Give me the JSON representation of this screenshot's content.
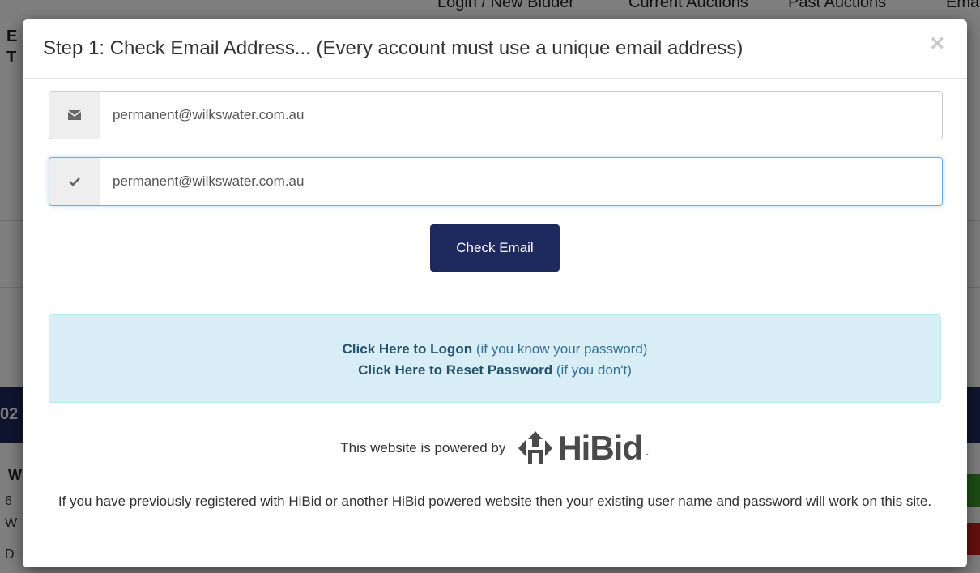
{
  "background": {
    "nav": [
      "Login / New Bidder",
      "Current Auctions",
      "Past Auctions",
      "Ema"
    ],
    "left_letters": [
      "E",
      "T"
    ],
    "banner_text": "02",
    "left_col": [
      "W",
      "6",
      "W",
      "D"
    ]
  },
  "modal": {
    "title": "Step 1: Check Email Address... (Every account must use a unique email address)",
    "close_label": "×",
    "email_value": "permanent@wilkswater.com.au",
    "confirm_email_value": "permanent@wilkswater.com.au",
    "check_button": "Check Email",
    "alert": {
      "logon_link": "Click Here to Logon",
      "logon_hint": " (if you know your password)",
      "reset_link": "Click Here to Reset Password",
      "reset_hint": " (if you don't)"
    },
    "powered_by": "This website is powered by",
    "logo_text": "HiBid",
    "logo_suffix": ".",
    "footer_note": "If you have previously registered with HiBid or another HiBid powered website then your existing user name and password will work on this site."
  },
  "colors": {
    "primary": "#1e2a5e",
    "alert_bg": "#d9edf7",
    "alert_text": "#31708f"
  }
}
